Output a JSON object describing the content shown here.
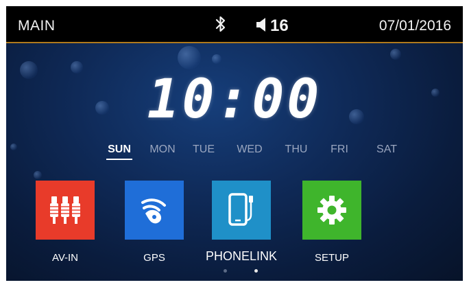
{
  "header": {
    "title": "MAIN",
    "bluetooth_icon": "bluetooth-icon",
    "volume_icon": "speaker-icon",
    "volume": "16",
    "date": "07/01/2016"
  },
  "clock": {
    "time": "10:00"
  },
  "days": [
    {
      "label": "SUN",
      "active": true
    },
    {
      "label": "MON",
      "active": false
    },
    {
      "label": "TUE",
      "active": false
    },
    {
      "label": "WED",
      "active": false
    },
    {
      "label": "THU",
      "active": false
    },
    {
      "label": "FRI",
      "active": false
    },
    {
      "label": "SAT",
      "active": false
    }
  ],
  "apps": [
    {
      "label": "AV-IN",
      "color": "#e83b2a",
      "icon": "rca-jack-icon"
    },
    {
      "label": "GPS",
      "color": "#1f6ed8",
      "icon": "navigation-signal-icon"
    },
    {
      "label": "PHONELINK",
      "color": "#1f90c8",
      "icon": "phone-link-icon"
    },
    {
      "label": "SETUP",
      "color": "#3fb52c",
      "icon": "gear-icon"
    }
  ],
  "pager": {
    "pages": 2,
    "current": 2
  },
  "colors": {
    "accent_line": "#b07a1c"
  }
}
